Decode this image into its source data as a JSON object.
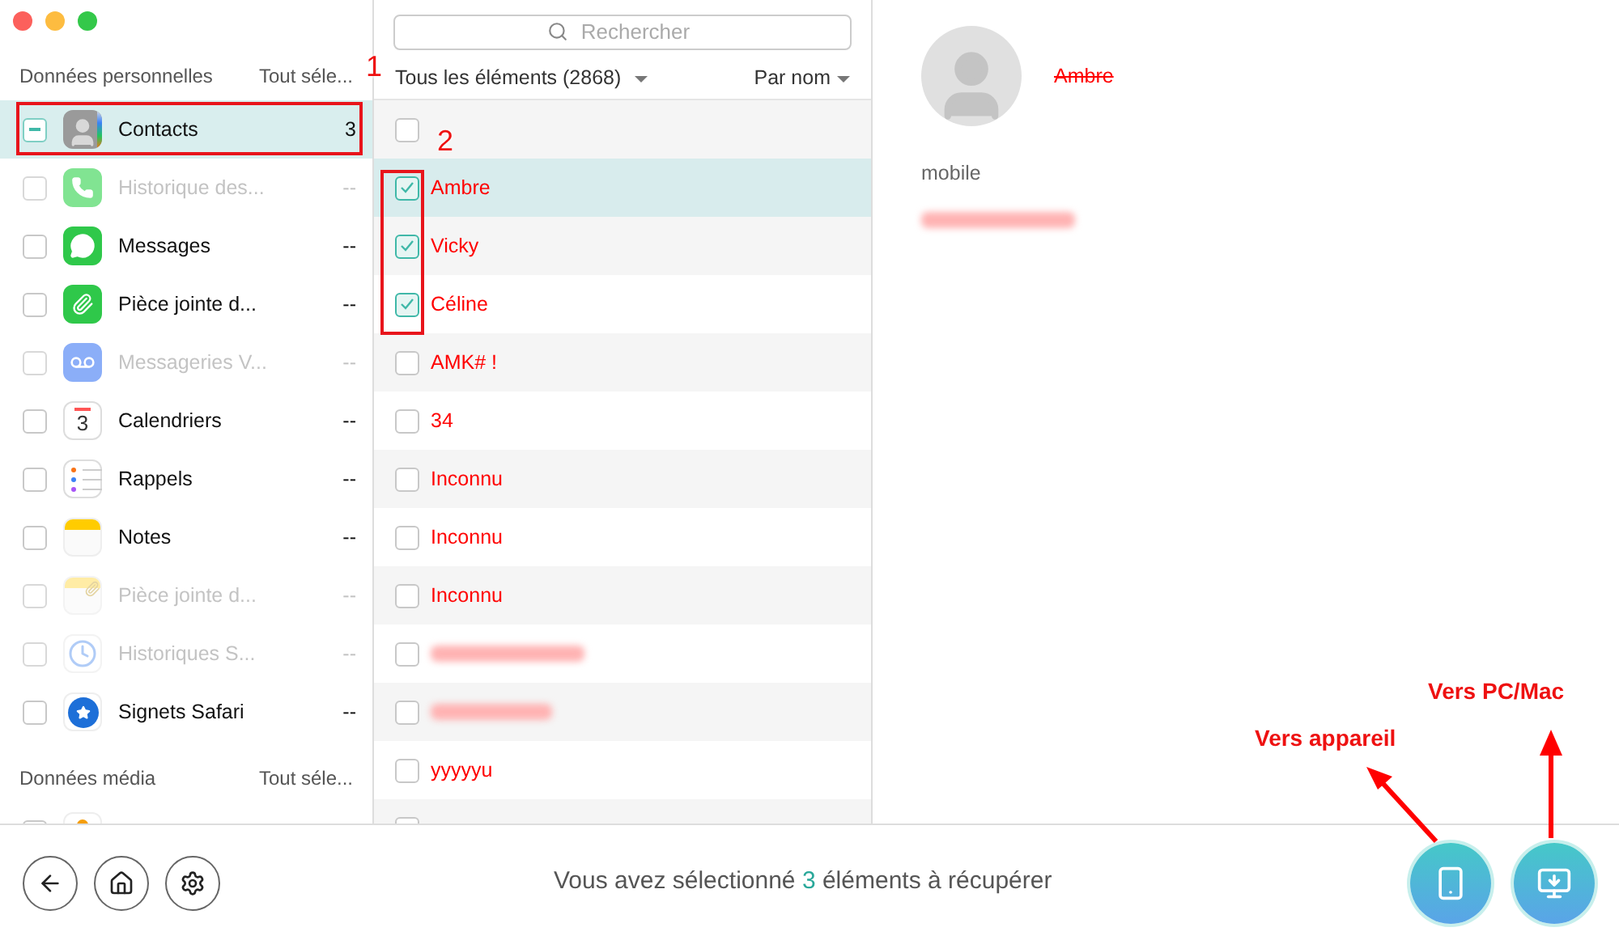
{
  "sidebar": {
    "sections": [
      {
        "title": "Données personnelles",
        "select_all": "Tout séle...",
        "items": [
          {
            "kind": "contacts",
            "label": "Contacts",
            "count": "3",
            "partial": true,
            "selected": true,
            "disabled": false
          },
          {
            "kind": "phone",
            "label": "Historique des...",
            "count": "--",
            "partial": false,
            "selected": false,
            "disabled": true
          },
          {
            "kind": "messages",
            "label": "Messages",
            "count": "--",
            "partial": false,
            "selected": false,
            "disabled": false
          },
          {
            "kind": "attachment",
            "label": "Pièce jointe d...",
            "count": "--",
            "partial": false,
            "selected": false,
            "disabled": false
          },
          {
            "kind": "voicemail",
            "label": "Messageries V...",
            "count": "--",
            "partial": false,
            "selected": false,
            "disabled": true
          },
          {
            "kind": "calendar",
            "label": "Calendriers",
            "count": "--",
            "partial": false,
            "selected": false,
            "disabled": false,
            "icon_text": "3"
          },
          {
            "kind": "reminders",
            "label": "Rappels",
            "count": "--",
            "partial": false,
            "selected": false,
            "disabled": false
          },
          {
            "kind": "notes",
            "label": "Notes",
            "count": "--",
            "partial": false,
            "selected": false,
            "disabled": false
          },
          {
            "kind": "note-attachment",
            "label": "Pièce jointe d...",
            "count": "--",
            "partial": false,
            "selected": false,
            "disabled": true
          },
          {
            "kind": "history",
            "label": "Historiques S...",
            "count": "--",
            "partial": false,
            "selected": false,
            "disabled": true
          },
          {
            "kind": "bookmarks",
            "label": "Signets Safari",
            "count": "--",
            "partial": false,
            "selected": false,
            "disabled": false
          }
        ]
      },
      {
        "title": "Données média",
        "select_all": "Tout séle...",
        "items": [
          {
            "kind": "photos",
            "partial": false,
            "selected": false,
            "disabled": false
          }
        ]
      }
    ]
  },
  "list": {
    "search": {
      "placeholder": "Rechercher"
    },
    "filter": "Tous les éléments (2868)",
    "sort": "Par nom",
    "rows": [
      {
        "kind": "select-all",
        "checked": false,
        "selected": false
      },
      {
        "kind": "text",
        "name": "Ambre",
        "checked": true,
        "selected": true
      },
      {
        "kind": "text",
        "name": "Vicky",
        "checked": true,
        "selected": false
      },
      {
        "kind": "text",
        "name": "Céline",
        "checked": true,
        "selected": false
      },
      {
        "kind": "text",
        "name": "AMK# !",
        "checked": false,
        "selected": false
      },
      {
        "kind": "text",
        "name": "34",
        "checked": false,
        "selected": false
      },
      {
        "kind": "text",
        "name": "Inconnu",
        "checked": false,
        "selected": false
      },
      {
        "kind": "text",
        "name": "Inconnu",
        "checked": false,
        "selected": false
      },
      {
        "kind": "text",
        "name": "Inconnu",
        "checked": false,
        "selected": false
      },
      {
        "kind": "redacted",
        "checked": false,
        "selected": false
      },
      {
        "kind": "redacted",
        "checked": false,
        "selected": false
      },
      {
        "kind": "text",
        "name": "yyyyyu",
        "checked": false,
        "selected": false
      },
      {
        "kind": "select-all",
        "checked": false,
        "selected": false
      }
    ]
  },
  "detail": {
    "name": "Ambre",
    "field_label": "mobile"
  },
  "footer": {
    "status_before": "Vous avez sélectionné",
    "status_count": "3",
    "status_after": "éléments à récupérer"
  },
  "annotations": [
    {
      "text": "1"
    },
    {
      "text": "2"
    },
    {
      "text": "Vers appareil"
    },
    {
      "text": "Vers PC/Mac"
    }
  ]
}
